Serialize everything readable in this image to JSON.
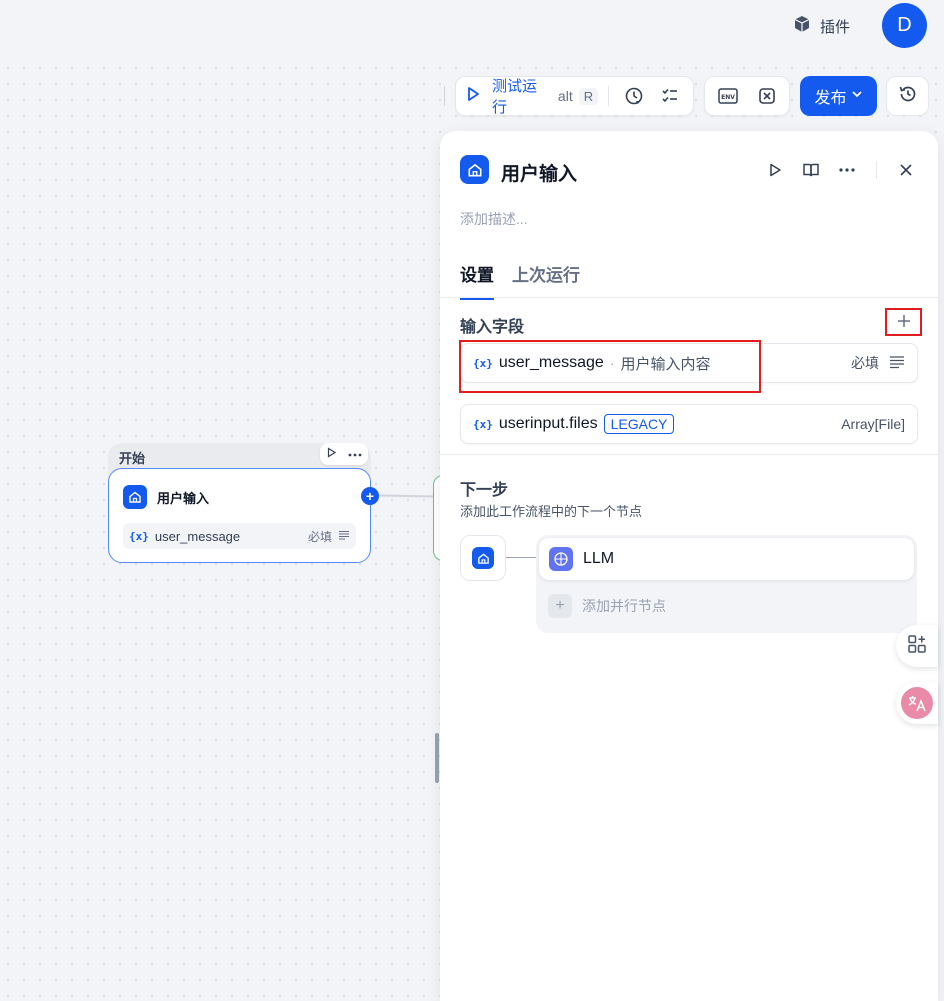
{
  "header": {
    "plugin_label": "插件",
    "avatar_letter": "D"
  },
  "toolbar": {
    "run_label": "测试运行",
    "run_shortcut_mod": "alt",
    "run_shortcut_key": "R",
    "publish_label": "发布"
  },
  "canvas": {
    "start_node": {
      "group_label": "开始",
      "title": "用户输入",
      "variable": "user_message",
      "required_label": "必填"
    }
  },
  "panel": {
    "title": "用户输入",
    "description_placeholder": "添加描述...",
    "tabs": [
      {
        "label": "设置",
        "active": true
      },
      {
        "label": "上次运行",
        "active": false
      }
    ],
    "input_fields_title": "输入字段",
    "fields": [
      {
        "name": "user_message",
        "separator": "·",
        "description": "用户输入内容",
        "right_label": "必填"
      },
      {
        "name": "userinput.files",
        "badge": "LEGACY",
        "right_label": "Array[File]"
      }
    ],
    "next_step_title": "下一步",
    "next_step_desc": "添加此工作流程中的下一个节点",
    "next_nodes": [
      {
        "label": "LLM"
      }
    ],
    "add_parallel_label": "添加并行节点"
  },
  "colors": {
    "accent": "#155aef",
    "highlight": "#e11d1d"
  }
}
